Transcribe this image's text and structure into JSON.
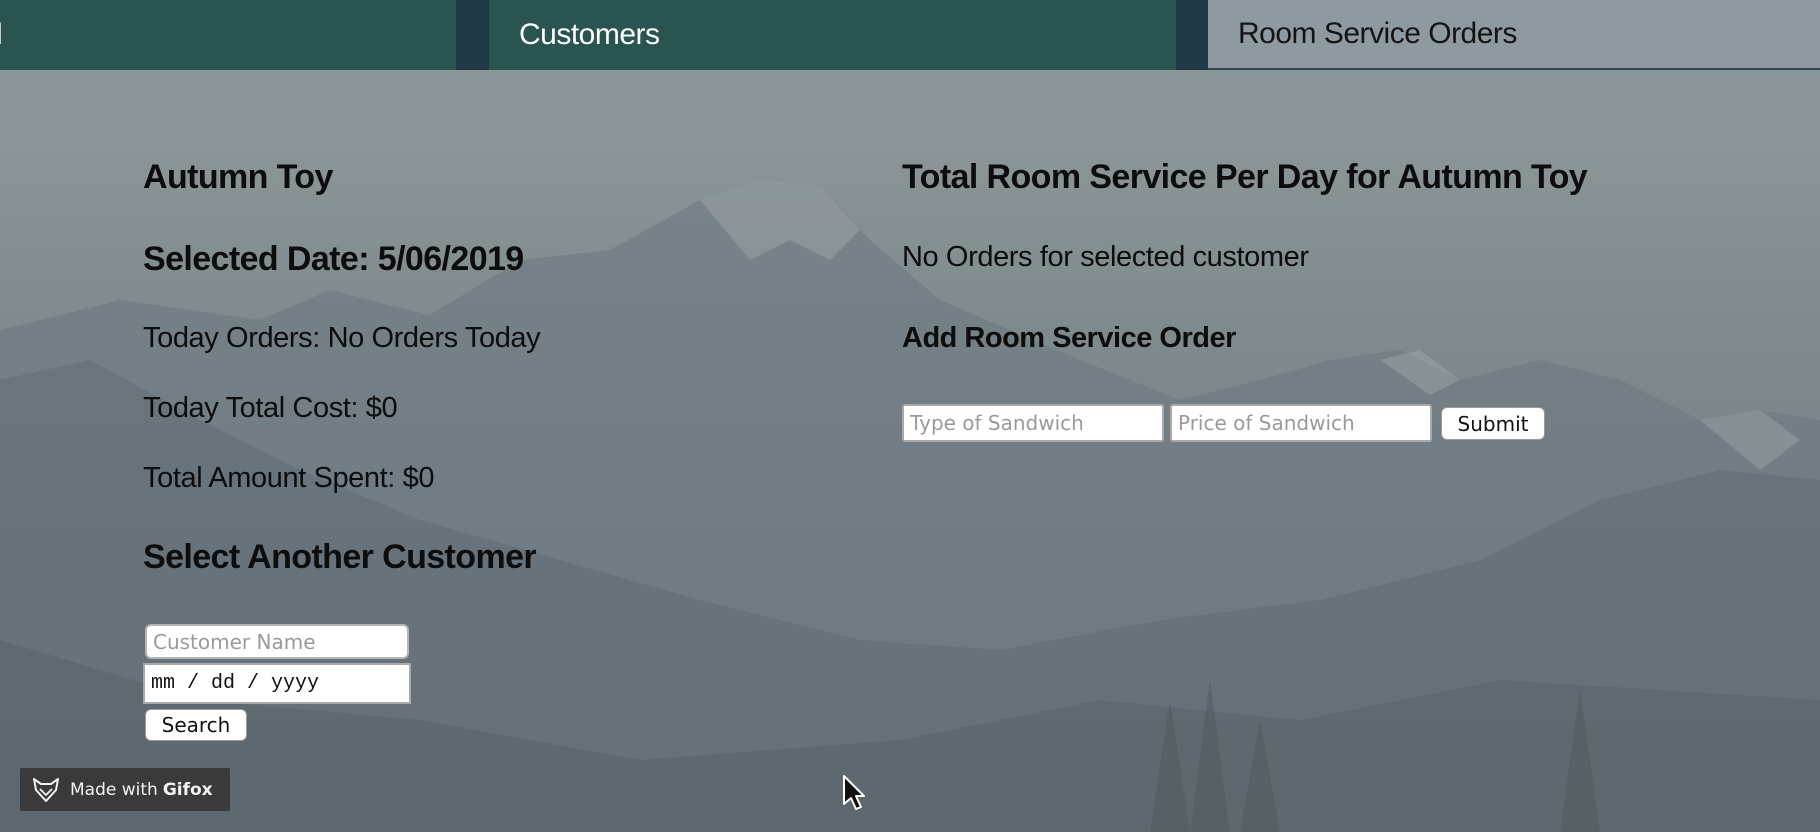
{
  "nav": {
    "tabs": [
      {
        "label": "d"
      },
      {
        "label": "Customers"
      },
      {
        "label": "Room Service Orders"
      }
    ]
  },
  "customer": {
    "name": "Autumn Toy",
    "selected_date": "Selected Date: 5/06/2019",
    "today_orders": "Today Orders: No Orders Today",
    "today_total_cost": "Today Total Cost: $0",
    "total_amount_spent": "Total Amount Spent: $0"
  },
  "search": {
    "heading": "Select Another Customer",
    "name_placeholder": "Customer Name",
    "date_placeholder": "mm / dd / yyyy",
    "button_label": "Search"
  },
  "room_service": {
    "heading": "Total Room Service Per Day for Autumn Toy",
    "empty_message": "No Orders for selected customer",
    "add_heading": "Add Room Service Order",
    "type_placeholder": "Type of Sandwich",
    "price_placeholder": "Price of Sandwich",
    "submit_label": "Submit"
  },
  "badge": {
    "prefix": "Made with",
    "brand": "Gifox"
  },
  "icons": {
    "badge_logo": "fox-logo-icon",
    "cursor": "mouse-cursor-icon"
  },
  "colors": {
    "nav_dark": "#2a5450",
    "nav_light": "#8e9aa0",
    "nav_separator": "#1f3a45"
  }
}
